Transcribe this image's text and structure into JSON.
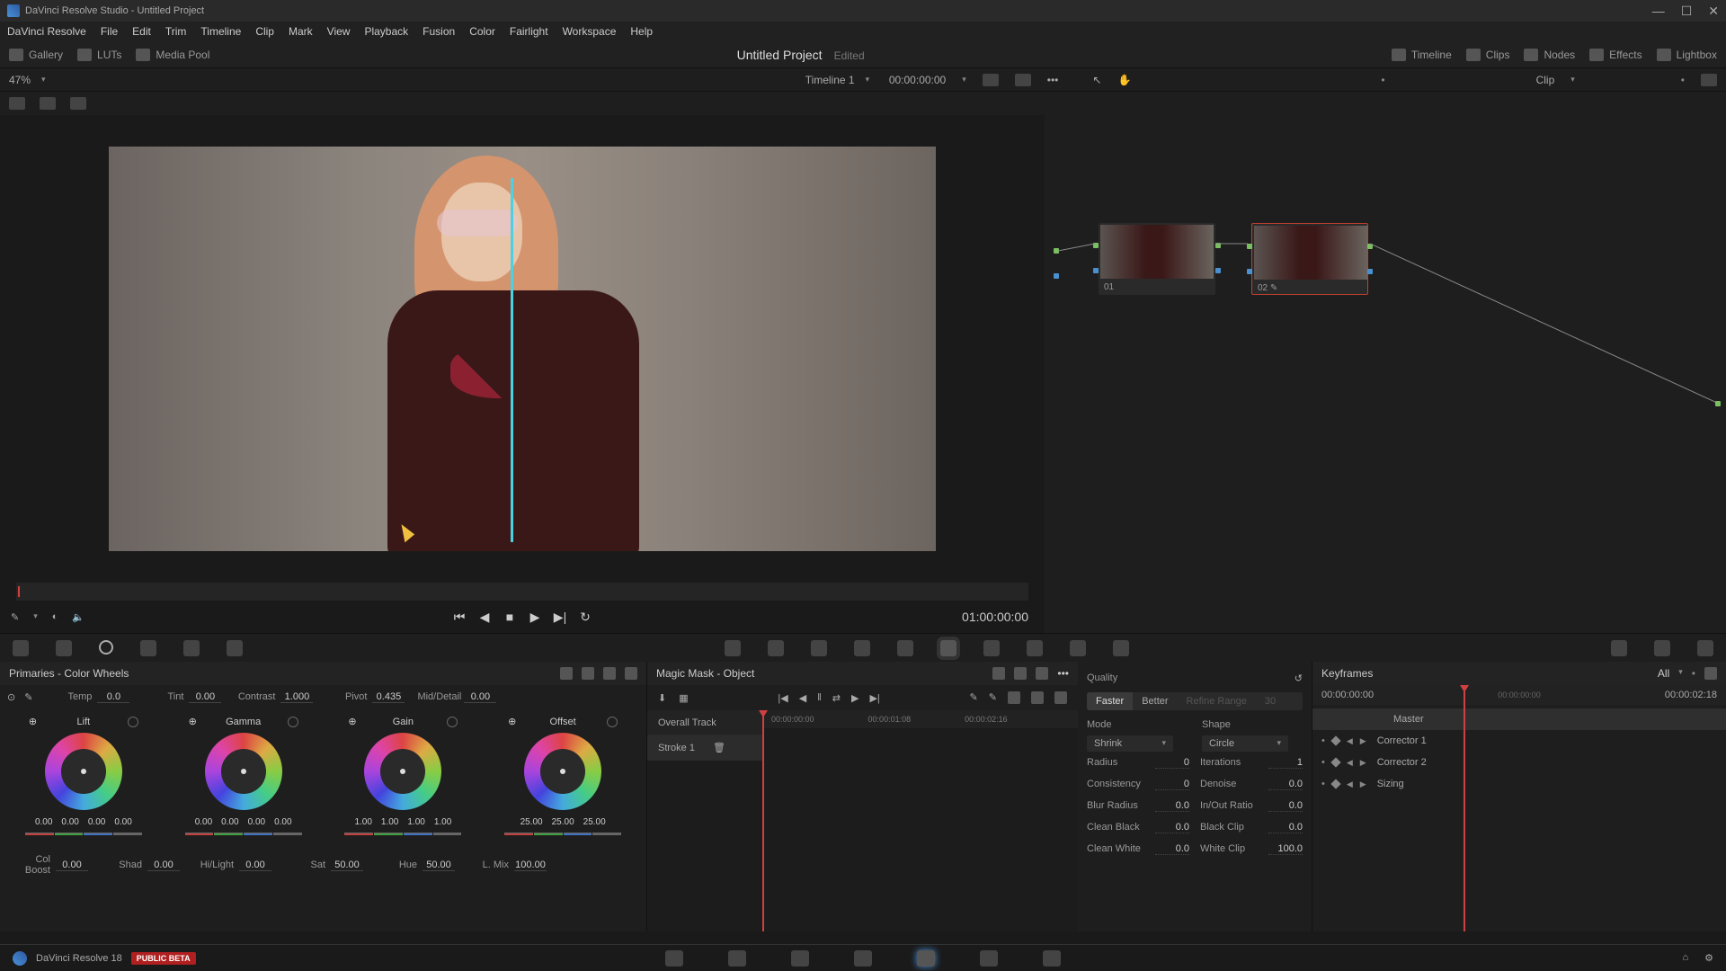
{
  "window": {
    "title": "DaVinci Resolve Studio - Untitled Project"
  },
  "menus": [
    "DaVinci Resolve",
    "File",
    "Edit",
    "Trim",
    "Timeline",
    "Clip",
    "Mark",
    "View",
    "Playback",
    "Fusion",
    "Color",
    "Fairlight",
    "Workspace",
    "Help"
  ],
  "toolbar": {
    "left": [
      {
        "name": "gallery",
        "label": "Gallery"
      },
      {
        "name": "luts",
        "label": "LUTs"
      },
      {
        "name": "media-pool",
        "label": "Media Pool"
      }
    ],
    "project": "Untitled Project",
    "edited": "Edited",
    "right": [
      {
        "name": "timeline",
        "label": "Timeline"
      },
      {
        "name": "clips",
        "label": "Clips"
      },
      {
        "name": "nodes",
        "label": "Nodes"
      },
      {
        "name": "effects",
        "label": "Effects"
      },
      {
        "name": "lightbox",
        "label": "Lightbox"
      }
    ]
  },
  "subbar": {
    "zoom": "47%",
    "timeline_name": "Timeline 1",
    "timecode": "00:00:00:00",
    "clip_label": "Clip"
  },
  "transport": {
    "tc": "01:00:00:00"
  },
  "nodes": [
    {
      "id": "01",
      "label": "01"
    },
    {
      "id": "02",
      "label": "02"
    }
  ],
  "primaries": {
    "title": "Primaries - Color Wheels",
    "top_adjust": [
      {
        "label": "Temp",
        "value": "0.0"
      },
      {
        "label": "Tint",
        "value": "0.00"
      },
      {
        "label": "Contrast",
        "value": "1.000"
      },
      {
        "label": "Pivot",
        "value": "0.435"
      },
      {
        "label": "Mid/Detail",
        "value": "0.00"
      }
    ],
    "wheels": [
      {
        "name": "Lift",
        "vals": [
          "0.00",
          "0.00",
          "0.00",
          "0.00"
        ]
      },
      {
        "name": "Gamma",
        "vals": [
          "0.00",
          "0.00",
          "0.00",
          "0.00"
        ]
      },
      {
        "name": "Gain",
        "vals": [
          "1.00",
          "1.00",
          "1.00",
          "1.00"
        ]
      },
      {
        "name": "Offset",
        "vals": [
          "25.00",
          "25.00",
          "25.00"
        ]
      }
    ],
    "bottom_adjust": [
      {
        "label": "Col Boost",
        "value": "0.00"
      },
      {
        "label": "Shad",
        "value": "0.00"
      },
      {
        "label": "Hi/Light",
        "value": "0.00"
      },
      {
        "label": "Sat",
        "value": "50.00"
      },
      {
        "label": "Hue",
        "value": "50.00"
      },
      {
        "label": "L. Mix",
        "value": "100.00"
      }
    ]
  },
  "magic_mask": {
    "title": "Magic Mask - Object",
    "ruler": [
      "00:00:00:00",
      "00:00:01:08",
      "00:00:02:16"
    ],
    "tracks": [
      {
        "label": "Overall Track"
      },
      {
        "label": "Stroke 1"
      }
    ],
    "quality": {
      "label": "Quality",
      "faster": "Faster",
      "better": "Better",
      "refine": "Refine Range",
      "refine_val": "30"
    },
    "mode": {
      "label": "Mode",
      "value": "Shrink"
    },
    "shape": {
      "label": "Shape",
      "value": "Circle"
    },
    "props": [
      {
        "l": "Radius",
        "v": "0",
        "l2": "Iterations",
        "v2": "1"
      },
      {
        "l": "Consistency",
        "v": "0",
        "l2": "Denoise",
        "v2": "0.0"
      },
      {
        "l": "Blur Radius",
        "v": "0.0",
        "l2": "In/Out Ratio",
        "v2": "0.0"
      },
      {
        "l": "Clean Black",
        "v": "0.0",
        "l2": "Black Clip",
        "v2": "0.0"
      },
      {
        "l": "Clean White",
        "v": "0.0",
        "l2": "White Clip",
        "v2": "100.0"
      }
    ]
  },
  "keyframes": {
    "title": "Keyframes",
    "all": "All",
    "tc1": "00:00:00:00",
    "tc2": "00:00:02:18",
    "rows": [
      "Master",
      "Corrector 1",
      "Corrector 2",
      "Sizing"
    ]
  },
  "footer": {
    "app": "DaVinci Resolve 18",
    "beta": "PUBLIC BETA"
  }
}
